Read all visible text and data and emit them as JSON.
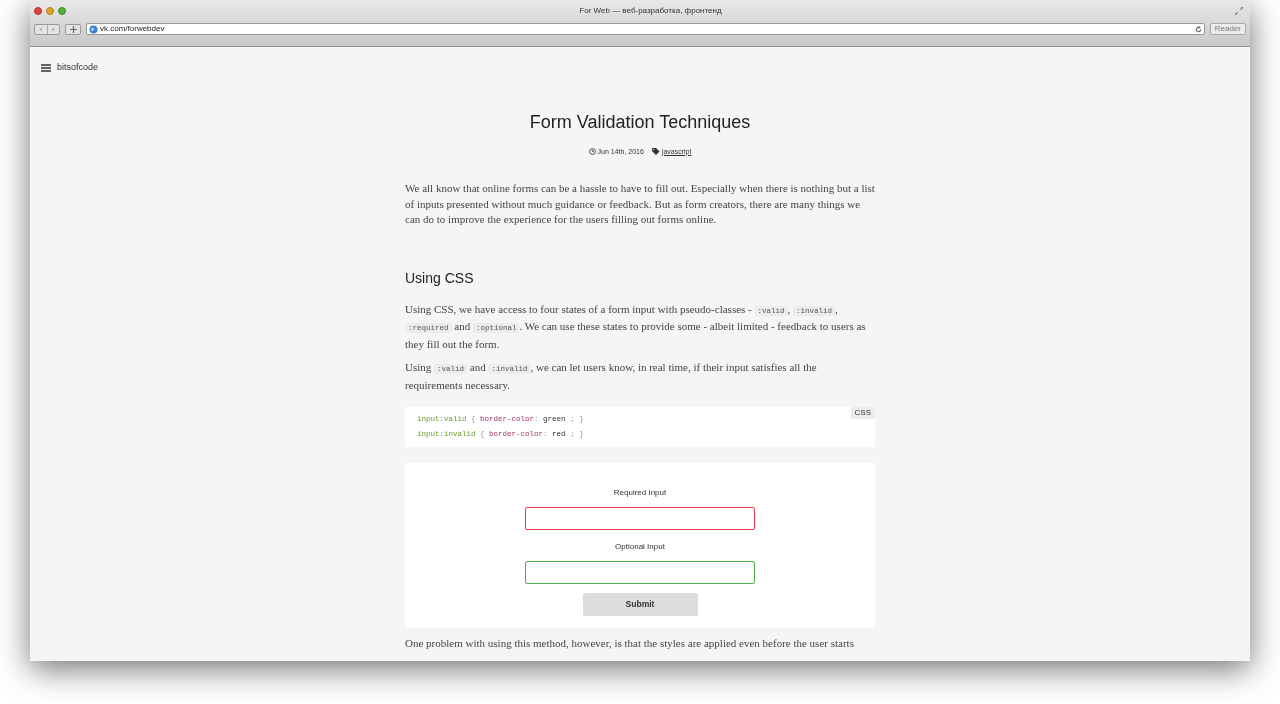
{
  "window": {
    "title": "For Web — веб-разработка, фронтенд",
    "address": "vk.com/forwebdev",
    "reader_button": "Reader"
  },
  "site": {
    "menu_label": "bitsofcode"
  },
  "article": {
    "title": "Form Validation Techniques",
    "date": "Jun 14th, 2016",
    "tag": "javascript",
    "blocks": [
      {
        "kind": "paragraph",
        "segments": [
          {
            "kind": "text",
            "text": "We all know that online forms can be a hassle to have to fill out. Especially when there is nothing but a list of inputs presented without much guidance or feedback. But as form creators, there are many things we can do to improve the experience for the users filling out forms online."
          }
        ]
      },
      {
        "kind": "heading",
        "text": "Using CSS"
      },
      {
        "kind": "paragraph",
        "segments": [
          {
            "kind": "text",
            "text": "Using CSS, we have access to four states of a form input with pseudo-classes -"
          },
          {
            "kind": "code",
            "text": ":valid"
          },
          {
            "kind": "text",
            "text": ","
          },
          {
            "kind": "code",
            "text": ":invalid"
          },
          {
            "kind": "text",
            "text": ","
          },
          {
            "kind": "code",
            "text": ":required"
          },
          {
            "kind": "text",
            "text": "and"
          },
          {
            "kind": "code",
            "text": ":optional"
          },
          {
            "kind": "text",
            "text": ". We can use these states to provide some - albeit limited - feedback to users as they fill out the form."
          }
        ]
      },
      {
        "kind": "paragraph",
        "segments": [
          {
            "kind": "text",
            "text": "Using"
          },
          {
            "kind": "code",
            "text": ":valid"
          },
          {
            "kind": "text",
            "text": "and"
          },
          {
            "kind": "code",
            "text": ":invalid"
          },
          {
            "kind": "text",
            "text": ", we can let users know, in real time, if their input satisfies all the requirements necessary."
          }
        ]
      },
      {
        "kind": "codeblock",
        "language": "CSS",
        "lines": [
          [
            {
              "kind": "selector",
              "text": "input:valid"
            },
            {
              "kind": "punct",
              "text": "{"
            },
            {
              "kind": "property",
              "text": "border-color"
            },
            {
              "kind": "punct",
              "text": ":"
            },
            {
              "kind": "value",
              "text": "green"
            },
            {
              "kind": "punct",
              "text": "; }"
            }
          ],
          [
            {
              "kind": "selector",
              "text": "input:invalid"
            },
            {
              "kind": "punct",
              "text": "{"
            },
            {
              "kind": "property",
              "text": "border-color"
            },
            {
              "kind": "punct",
              "text": ":"
            },
            {
              "kind": "value",
              "text": "red"
            },
            {
              "kind": "punct",
              "text": "; }"
            }
          ]
        ]
      },
      {
        "kind": "demo",
        "fields": [
          {
            "label": "Required Input",
            "valid": false
          },
          {
            "label": "Optional Input",
            "valid": true
          }
        ],
        "button": "Submit"
      },
      {
        "kind": "paragraph",
        "segments": [
          {
            "kind": "text",
            "text": "One problem with using this method, however, is that the styles are applied even before the user starts"
          }
        ]
      }
    ]
  }
}
